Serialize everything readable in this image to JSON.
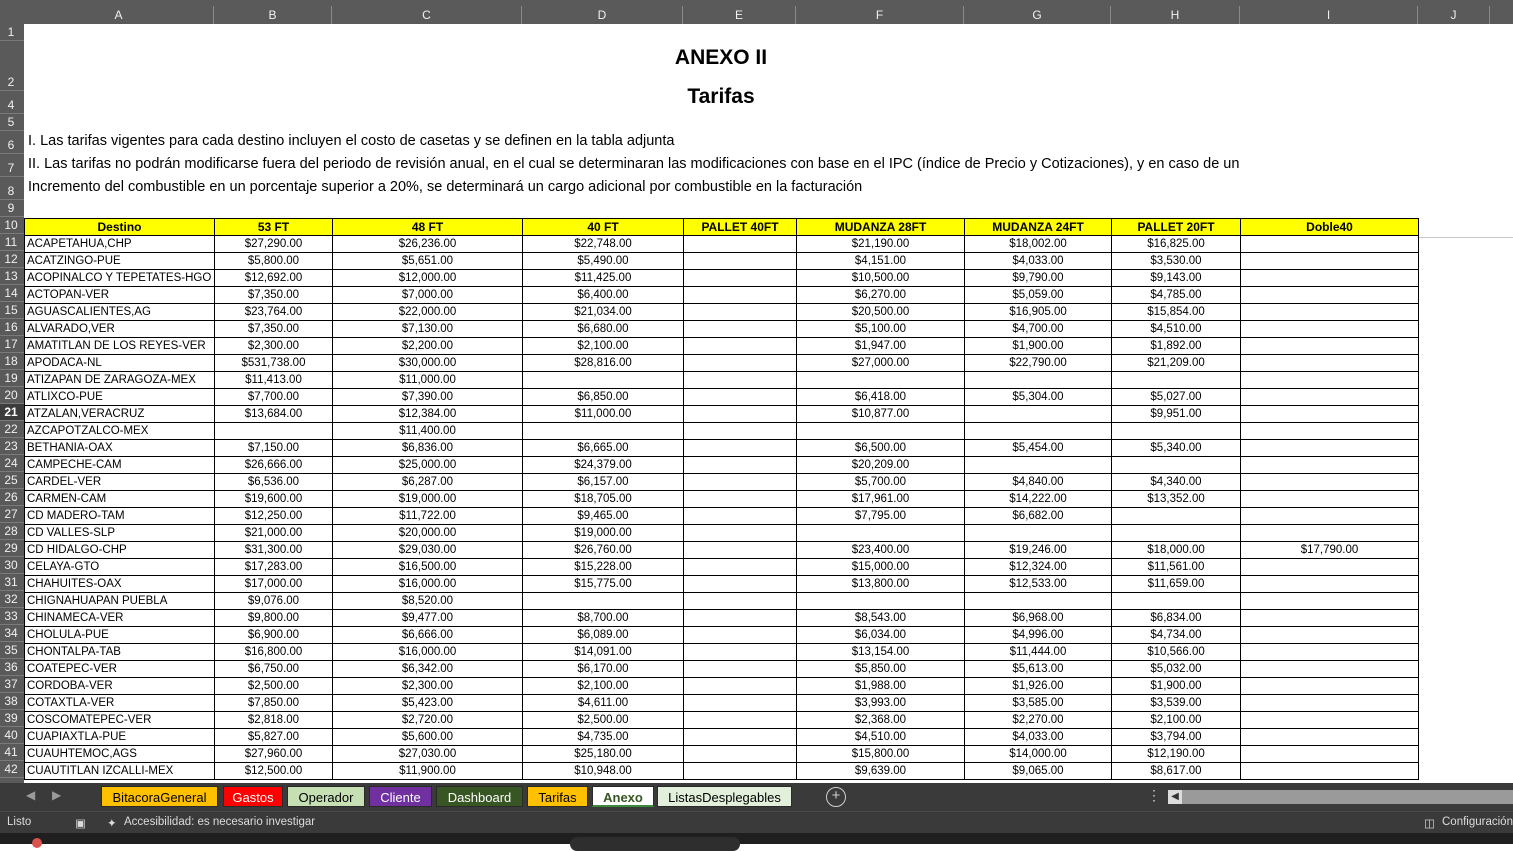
{
  "columns": [
    "A",
    "B",
    "C",
    "D",
    "E",
    "F",
    "G",
    "H",
    "I",
    "J"
  ],
  "rows_visible": [
    "1",
    "2",
    "4",
    "5",
    "6",
    "7",
    "8",
    "9",
    "10",
    "11",
    "12",
    "13",
    "14",
    "15",
    "16",
    "17",
    "18",
    "19",
    "20",
    "21",
    "22",
    "23",
    "24",
    "25",
    "26",
    "27",
    "28",
    "29",
    "30",
    "31",
    "32",
    "33",
    "34",
    "35",
    "36",
    "37",
    "38",
    "39",
    "40",
    "41",
    "42"
  ],
  "selected_row": "21",
  "sheet": {
    "title": "ANEXO II",
    "subtitle": "Tarifas",
    "notes": [
      "I. Las tarifas vigentes para cada destino incluyen el costo de casetas y se definen en la tabla adjunta",
      "II. Las tarifas no podrán modificarse fuera del periodo de revisión anual, en el cual se determinaran las modificaciones con base en el IPC (índice de Precio y Cotizaciones), y en caso de un",
      "Incremento del combustible en un porcentaje superior a 20%, se determinará un cargo adicional por combustible en la facturación"
    ]
  },
  "table": {
    "headers": [
      "Destino",
      "53 FT",
      "48 FT",
      "40 FT",
      "PALLET 40FT",
      "MUDANZA 28FT",
      "MUDANZA 24FT",
      "PALLET 20FT",
      "Doble40"
    ],
    "rows": [
      [
        "ACAPETAHUA,CHP",
        "$27,290.00",
        "$26,236.00",
        "$22,748.00",
        "",
        "$21,190.00",
        "$18,002.00",
        "$16,825.00",
        ""
      ],
      [
        "ACATZINGO-PUE",
        "$5,800.00",
        "$5,651.00",
        "$5,490.00",
        "",
        "$4,151.00",
        "$4,033.00",
        "$3,530.00",
        ""
      ],
      [
        "ACOPINALCO Y TEPETATES-HGO",
        "$12,692.00",
        "$12,000.00",
        "$11,425.00",
        "",
        "$10,500.00",
        "$9,790.00",
        "$9,143.00",
        ""
      ],
      [
        "ACTOPAN-VER",
        "$7,350.00",
        "$7,000.00",
        "$6,400.00",
        "",
        "$6,270.00",
        "$5,059.00",
        "$4,785.00",
        ""
      ],
      [
        "AGUASCALIENTES,AG",
        "$23,764.00",
        "$22,000.00",
        "$21,034.00",
        "",
        "$20,500.00",
        "$16,905.00",
        "$15,854.00",
        ""
      ],
      [
        "ALVARADO,VER",
        "$7,350.00",
        "$7,130.00",
        "$6,680.00",
        "",
        "$5,100.00",
        "$4,700.00",
        "$4,510.00",
        ""
      ],
      [
        "AMATITLAN DE LOS REYES-VER",
        "$2,300.00",
        "$2,200.00",
        "$2,100.00",
        "",
        "$1,947.00",
        "$1,900.00",
        "$1,892.00",
        ""
      ],
      [
        "APODACA-NL",
        "$531,738.00",
        "$30,000.00",
        "$28,816.00",
        "",
        "$27,000.00",
        "$22,790.00",
        "$21,209.00",
        ""
      ],
      [
        "ATIZAPAN DE ZARAGOZA-MEX",
        "$11,413.00",
        "$11,000.00",
        "",
        "",
        "",
        "",
        "",
        ""
      ],
      [
        "ATLIXCO-PUE",
        "$7,700.00",
        "$7,390.00",
        "$6,850.00",
        "",
        "$6,418.00",
        "$5,304.00",
        "$5,027.00",
        ""
      ],
      [
        "ATZALAN,VERACRUZ",
        "$13,684.00",
        "$12,384.00",
        "$11,000.00",
        "",
        "$10,877.00",
        "",
        "$9,951.00",
        ""
      ],
      [
        "AZCAPOTZALCO-MEX",
        "",
        "$11,400.00",
        "",
        "",
        "",
        "",
        "",
        ""
      ],
      [
        "BETHANIA-OAX",
        "$7,150.00",
        "$6,836.00",
        "$6,665.00",
        "",
        "$6,500.00",
        "$5,454.00",
        "$5,340.00",
        ""
      ],
      [
        "CAMPECHE-CAM",
        "$26,666.00",
        "$25,000.00",
        "$24,379.00",
        "",
        "$20,209.00",
        "",
        "",
        ""
      ],
      [
        "CARDEL-VER",
        "$6,536.00",
        "$6,287.00",
        "$6,157.00",
        "",
        "$5,700.00",
        "$4,840.00",
        "$4,340.00",
        ""
      ],
      [
        "CARMEN-CAM",
        "$19,600.00",
        "$19,000.00",
        "$18,705.00",
        "",
        "$17,961.00",
        "$14,222.00",
        "$13,352.00",
        ""
      ],
      [
        "CD MADERO-TAM",
        "$12,250.00",
        "$11,722.00",
        "$9,465.00",
        "",
        "$7,795.00",
        "$6,682.00",
        "",
        ""
      ],
      [
        "CD VALLES-SLP",
        "$21,000.00",
        "$20,000.00",
        "$19,000.00",
        "",
        "",
        "",
        "",
        ""
      ],
      [
        "CD HIDALGO-CHP",
        "$31,300.00",
        "$29,030.00",
        "$26,760.00",
        "",
        "$23,400.00",
        "$19,246.00",
        "$18,000.00",
        "$17,790.00"
      ],
      [
        "CELAYA-GTO",
        "$17,283.00",
        "$16,500.00",
        "$15,228.00",
        "",
        "$15,000.00",
        "$12,324.00",
        "$11,561.00",
        ""
      ],
      [
        "CHAHUITES-OAX",
        "$17,000.00",
        "$16,000.00",
        "$15,775.00",
        "",
        "$13,800.00",
        "$12,533.00",
        "$11,659.00",
        ""
      ],
      [
        "CHIGNAHUAPAN PUEBLA",
        "$9,076.00",
        "$8,520.00",
        "",
        "",
        "",
        "",
        "",
        ""
      ],
      [
        "CHINAMECA-VER",
        "$9,800.00",
        "$9,477.00",
        "$8,700.00",
        "",
        "$8,543.00",
        "$6,968.00",
        "$6,834.00",
        ""
      ],
      [
        "CHOLULA-PUE",
        "$6,900.00",
        "$6,666.00",
        "$6,089.00",
        "",
        "$6,034.00",
        "$4,996.00",
        "$4,734.00",
        ""
      ],
      [
        "CHONTALPA-TAB",
        "$16,800.00",
        "$16,000.00",
        "$14,091.00",
        "",
        "$13,154.00",
        "$11,444.00",
        "$10,566.00",
        ""
      ],
      [
        "COATEPEC-VER",
        "$6,750.00",
        "$6,342.00",
        "$6,170.00",
        "",
        "$5,850.00",
        "$5,613.00",
        "$5,032.00",
        ""
      ],
      [
        "CORDOBA-VER",
        "$2,500.00",
        "$2,300.00",
        "$2,100.00",
        "",
        "$1,988.00",
        "$1,926.00",
        "$1,900.00",
        ""
      ],
      [
        "COTAXTLA-VER",
        "$7,850.00",
        "$5,423.00",
        "$4,611.00",
        "",
        "$3,993.00",
        "$3,585.00",
        "$3,539.00",
        ""
      ],
      [
        "COSCOMATEPEC-VER",
        "$2,818.00",
        "$2,720.00",
        "$2,500.00",
        "",
        "$2,368.00",
        "$2,270.00",
        "$2,100.00",
        ""
      ],
      [
        "CUAPIAXTLA-PUE",
        "$5,827.00",
        "$5,600.00",
        "$4,735.00",
        "",
        "$4,510.00",
        "$4,033.00",
        "$3,794.00",
        ""
      ],
      [
        "CUAUHTEMOC,AGS",
        "$27,960.00",
        "$27,030.00",
        "$25,180.00",
        "",
        "$15,800.00",
        "$14,000.00",
        "$12,190.00",
        ""
      ],
      [
        "CUAUTITLAN IZCALLI-MEX",
        "$12,500.00",
        "$11,900.00",
        "$10,948.00",
        "",
        "$9,639.00",
        "$9,065.00",
        "$8,617.00",
        ""
      ]
    ]
  },
  "tabs": [
    {
      "label": "BitacoraGeneral",
      "bg": "#ffc000",
      "fg": "#000000"
    },
    {
      "label": "Gastos",
      "bg": "#ff0000",
      "fg": "#ffffff"
    },
    {
      "label": "Operador",
      "bg": "#c6e0b4",
      "fg": "#000000"
    },
    {
      "label": "Cliente",
      "bg": "#7030a0",
      "fg": "#ffffff"
    },
    {
      "label": "Dashboard",
      "bg": "#375623",
      "fg": "#ffffff"
    },
    {
      "label": "Tarifas",
      "bg": "#ffc000",
      "fg": "#000000"
    },
    {
      "label": "Anexo",
      "bg": "#ffffff",
      "fg": "#375623"
    },
    {
      "label": "ListasDesplegables",
      "bg": "#e2efda",
      "fg": "#000000"
    }
  ],
  "active_tab": "Anexo",
  "status": {
    "ready": "Listo",
    "accessibility": "Accesibilidad: es necesario investigar",
    "config": "Configuración"
  },
  "icons": {
    "prev_sheet": "chevron-left-icon",
    "next_sheet": "chevron-right-icon",
    "add_sheet": "plus-circle-icon",
    "more": "vertical-dots-icon",
    "macro": "macro-record-icon",
    "accessibility": "accessibility-icon",
    "settings": "display-settings-icon"
  }
}
